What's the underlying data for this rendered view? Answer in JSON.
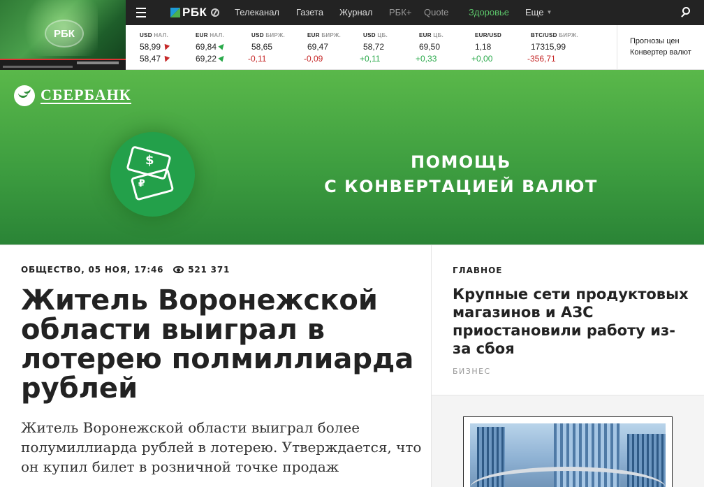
{
  "video": {
    "logo_text": "РБК"
  },
  "nav": {
    "logo_text": "РБК",
    "links": [
      {
        "label": "Телеканал"
      },
      {
        "label": "Газета"
      },
      {
        "label": "Журнал"
      },
      {
        "label": "РБК+"
      },
      {
        "label": "Quote"
      },
      {
        "label": "Здоровье"
      },
      {
        "label": "Еще"
      }
    ]
  },
  "quotes": {
    "columns": [
      {
        "cur": "USD",
        "src": "НАЛ.",
        "row1": "58,99",
        "row2": "58,47"
      },
      {
        "cur": "EUR",
        "src": "НАЛ.",
        "row1": "69,84",
        "row2": "69,22"
      },
      {
        "cur": "USD",
        "src": "БИРЖ.",
        "row1": "58,65",
        "row2": "-0,11"
      },
      {
        "cur": "EUR",
        "src": "БИРЖ.",
        "row1": "69,47",
        "row2": "-0,09"
      },
      {
        "cur": "USD",
        "src": "ЦБ.",
        "row1": "58,72",
        "row2": "+0,11"
      },
      {
        "cur": "EUR",
        "src": "ЦБ.",
        "row1": "69,50",
        "row2": "+0,33"
      },
      {
        "cur": "EUR/USD",
        "src": "",
        "row1": "1,18",
        "row2": "+0,00"
      },
      {
        "cur": "BTC/USD",
        "src": "БИРЖ.",
        "row1": "17315,99",
        "row2": "-356,71"
      }
    ],
    "links": {
      "forecast": "Прогнозы цен",
      "converter": "Конвертер валют"
    },
    "colors": {
      "up": "#29a94a",
      "down": "#c62828"
    }
  },
  "banner": {
    "brand": "СБЕРБАНК",
    "line1": "ПОМОЩЬ",
    "line2": "С КОНВЕРТАЦИЕЙ ВАЛЮТ",
    "icon_usd": "$",
    "icon_rub": "₽",
    "accent": "#21a038"
  },
  "article": {
    "category": "ОБЩЕСТВО",
    "date": "05 НОЯ, 17:46",
    "views": "521 371",
    "headline": "Житель Воронежской области выиграл в лотерею полмиллиарда рублей",
    "lead": "Житель Воронежской области выиграл более полумиллиарда рублей в лотерею. Утверждается, что он купил билет в розничной точке продаж"
  },
  "sidebar": {
    "label": "ГЛАВНОЕ",
    "title": "Крупные сети продуктовых магазинов и АЗС приостановили работу из-за сбоя",
    "tag": "БИЗНЕС"
  }
}
